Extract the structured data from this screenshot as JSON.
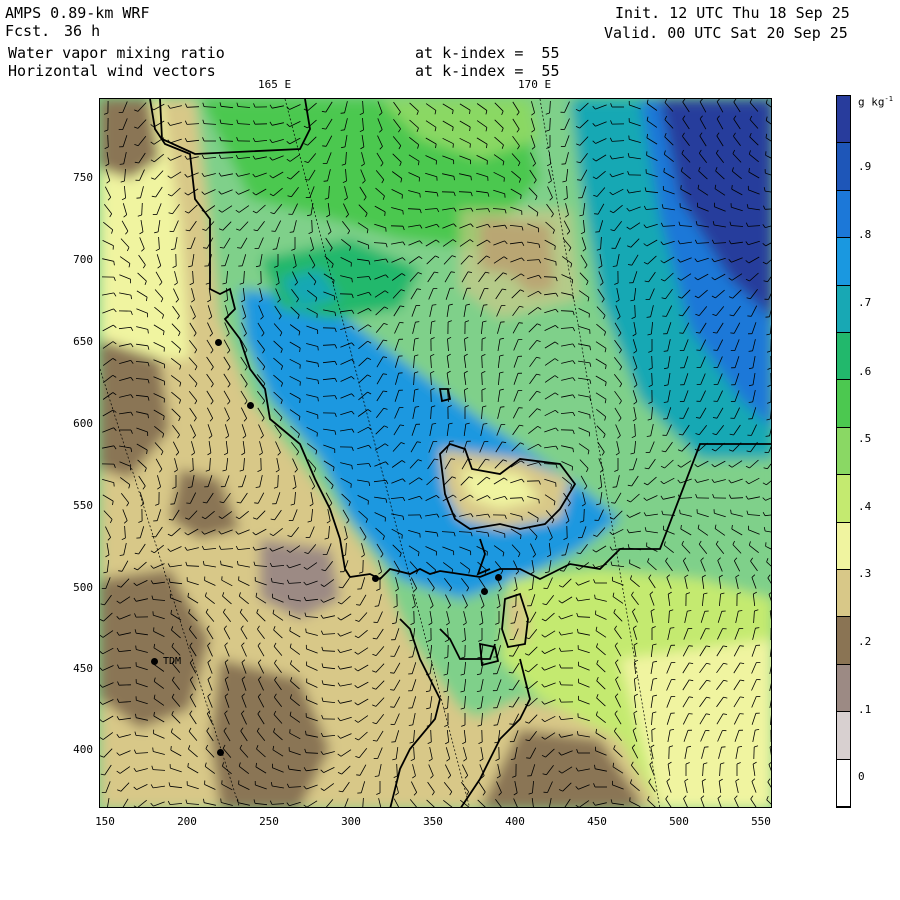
{
  "header": {
    "model": "AMPS 0.89-km WRF",
    "fcst_label": "Fcst.",
    "fcst_value": "36 h",
    "field1": "Water vapor mixing ratio",
    "field2": "Horizontal wind vectors",
    "level1": "at k-index =  55",
    "level2": "at k-index =  55",
    "init": "Init. 12 UTC Thu 18 Sep 25",
    "valid": "Valid. 00 UTC Sat 20 Sep 25"
  },
  "map": {
    "lon_labels": [
      "165 E",
      "170 E"
    ],
    "x_ticks": [
      "150",
      "200",
      "250",
      "300",
      "350",
      "400",
      "450",
      "500",
      "550"
    ],
    "y_ticks": [
      "750",
      "700",
      "650",
      "600",
      "550",
      "500",
      "450",
      "400"
    ],
    "station_label": "TDM"
  },
  "colorbar": {
    "unit": "g kg",
    "unit_exp": "-1",
    "labels": [
      ".9",
      ".8",
      ".7",
      ".6",
      ".5",
      ".4",
      ".3",
      ".2",
      ".1",
      "0"
    ],
    "colors": [
      "#283c9c",
      "#1e56b8",
      "#1c78d8",
      "#1a98e0",
      "#18a8b4",
      "#22b86c",
      "#4cc850",
      "#8ad864",
      "#c4ea70",
      "#f0f4a0",
      "#d8c888",
      "#8a7454",
      "#9c8a84",
      "#d8d0d0",
      "#ffffff"
    ]
  }
}
